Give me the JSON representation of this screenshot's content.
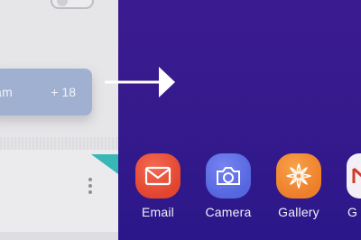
{
  "settings_screen": {
    "chip_text": "am",
    "chip_count": "+ 18"
  },
  "home_screen": {
    "apps": [
      {
        "label": "Email",
        "icon": "email-icon",
        "color": "#e2452f"
      },
      {
        "label": "Camera",
        "icon": "camera-icon",
        "color": "#5566df"
      },
      {
        "label": "Gallery",
        "icon": "gallery-icon",
        "color": "#ee7f2a"
      },
      {
        "label": "G",
        "icon": "gmail-icon",
        "color": "#f2f0f5"
      }
    ]
  },
  "colors": {
    "wallpaper": "#3a1d8f",
    "accent_teal": "#37b8b6"
  }
}
